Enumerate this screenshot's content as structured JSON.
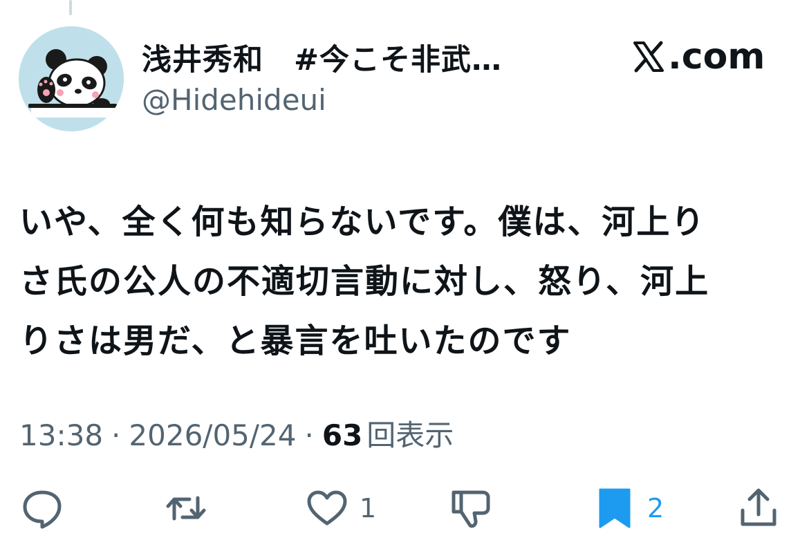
{
  "author": {
    "display_name": "浅井秀和　#今こそ非武…",
    "handle": "@Hidehideui",
    "avatar_icon": "panda-avatar-icon"
  },
  "source": {
    "logo_icon": "x-logo-icon",
    "label": ".com"
  },
  "tweet": {
    "lines": [
      "いや、全く何も知らないです。僕は、河上り",
      "さ氏の公人の不適切言動に対し、怒り、河上",
      "りさは男だ、と暴言を吐いたのです"
    ]
  },
  "meta": {
    "time": "13:38",
    "separator": "·",
    "date": "2026/05/24",
    "views_count": "63",
    "views_label": "回表示"
  },
  "actions": {
    "reply": {
      "icon": "reply-icon",
      "count": ""
    },
    "retweet": {
      "icon": "retweet-icon",
      "count": ""
    },
    "like": {
      "icon": "heart-icon",
      "count": "1"
    },
    "dislike": {
      "icon": "thumbs-down-icon",
      "count": ""
    },
    "bookmark": {
      "icon": "bookmark-icon",
      "count": "2"
    },
    "share": {
      "icon": "share-icon",
      "count": ""
    }
  },
  "colors": {
    "text": "#0f1419",
    "secondary": "#536471",
    "accent": "#1d9bf0",
    "avatar_bg": "#bfe0ea"
  }
}
